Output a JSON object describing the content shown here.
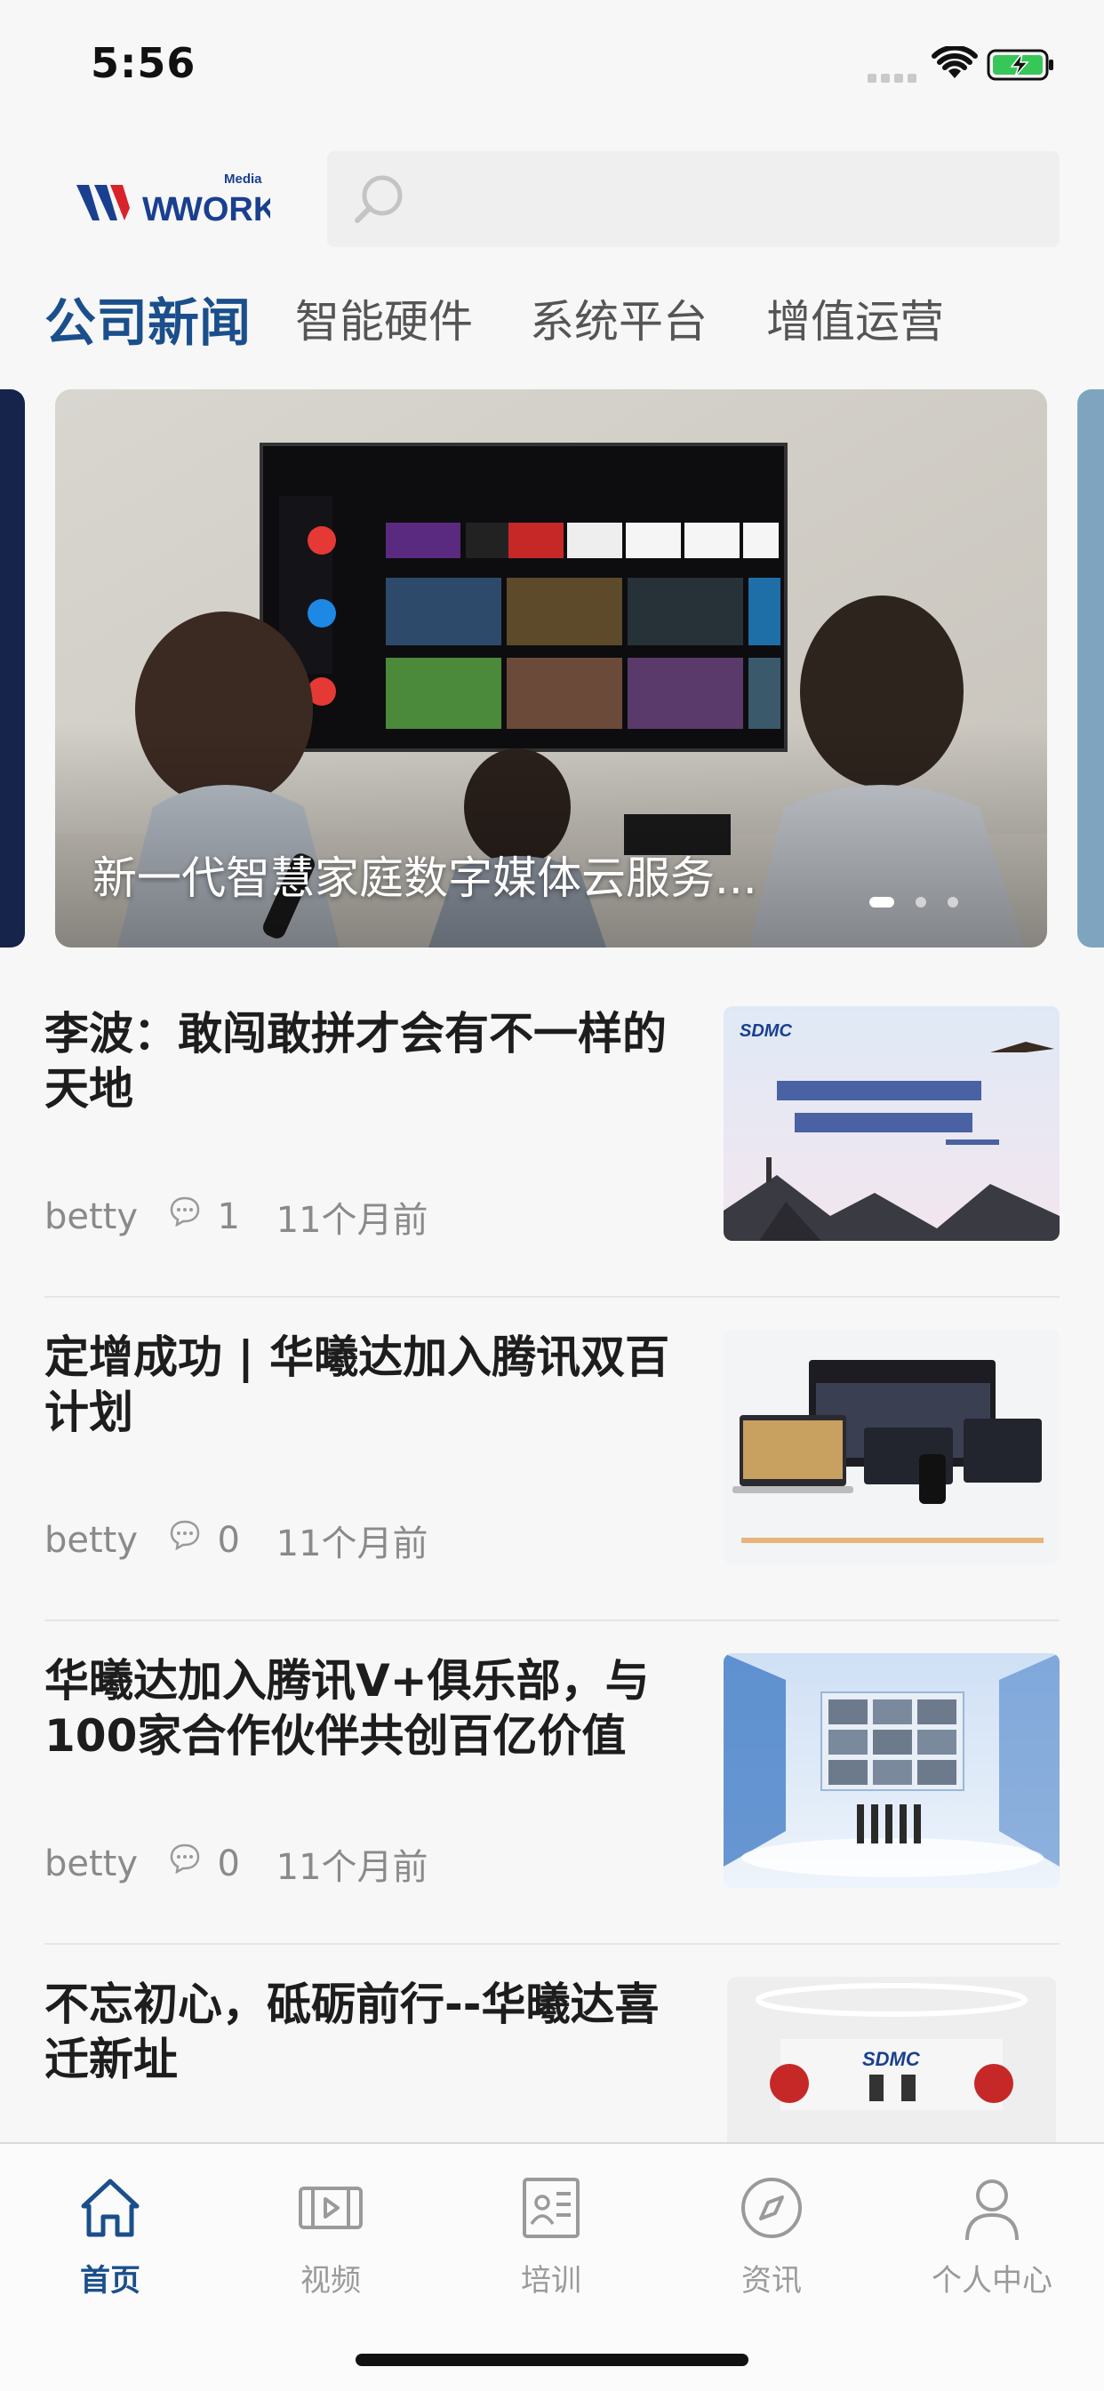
{
  "status_bar": {
    "time": "5:56"
  },
  "header": {
    "logo_text_main": "WORK",
    "logo_text_small": "Media",
    "search_placeholder": ""
  },
  "tabs": [
    {
      "label": "公司新闻",
      "active": true
    },
    {
      "label": "智能硬件",
      "active": false
    },
    {
      "label": "系统平台",
      "active": false
    },
    {
      "label": "增值运营",
      "active": false
    }
  ],
  "carousel": {
    "title": "新一代智慧家庭数字媒体云服务...",
    "dot_count": 3,
    "active_dot": 0
  },
  "news": [
    {
      "title": "李波：敢闯敢拼才会有不一样的天地",
      "author": "betty",
      "comments": "1",
      "time": "11个月前",
      "thumb": "banner-calligraphy-mountain"
    },
    {
      "title": "定增成功 | 华曦达加入腾讯双百计划",
      "author": "betty",
      "comments": "0",
      "time": "11个月前",
      "thumb": "devices-screens"
    },
    {
      "title": "华曦达加入腾讯V+俱乐部，与100家合作伙伴共创百亿价值",
      "author": "betty",
      "comments": "0",
      "time": "11个月前",
      "thumb": "stage-video-wall"
    },
    {
      "title": "不忘初心，砥砺前行--华曦达喜迁新址",
      "author": "",
      "comments": "",
      "time": "",
      "thumb": "office-reception"
    }
  ],
  "bottom_nav": [
    {
      "label": "首页",
      "icon": "home-icon",
      "active": true
    },
    {
      "label": "视频",
      "icon": "video-icon",
      "active": false
    },
    {
      "label": "培训",
      "icon": "training-icon",
      "active": false
    },
    {
      "label": "资讯",
      "icon": "compass-icon",
      "active": false
    },
    {
      "label": "个人中心",
      "icon": "user-icon",
      "active": false
    }
  ],
  "colors": {
    "accent": "#1b4f8c",
    "brand_red": "#d8232a",
    "brand_blue": "#1a3f8f"
  }
}
